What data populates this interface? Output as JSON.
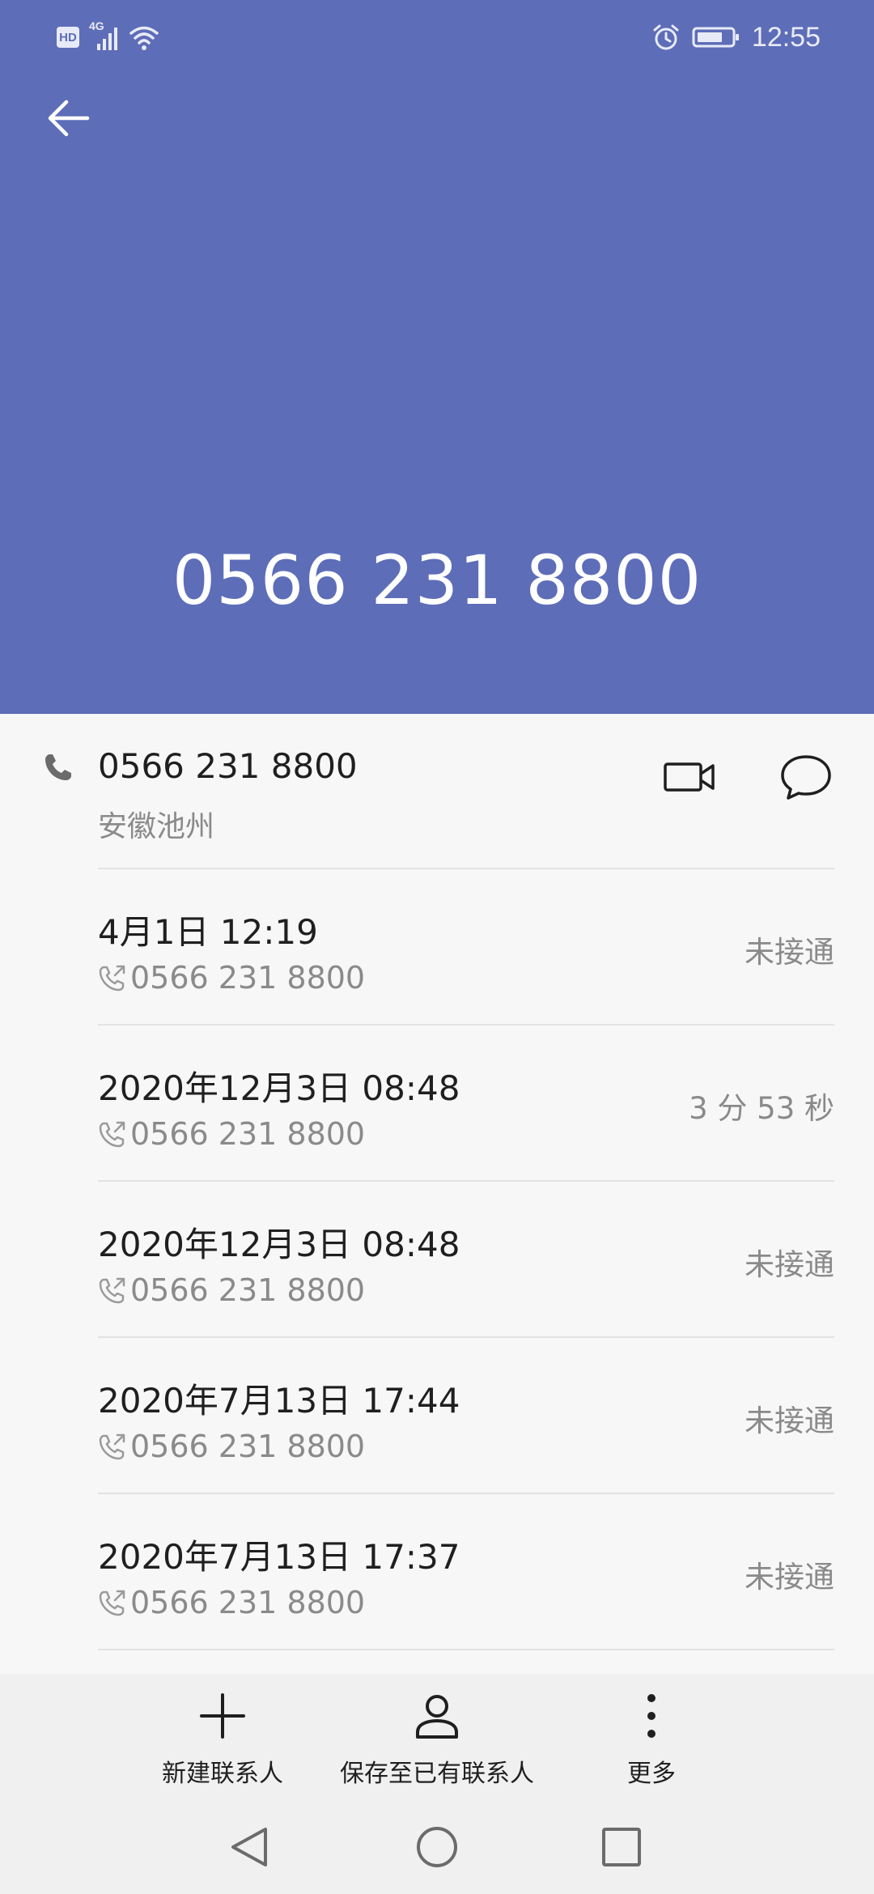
{
  "status_bar": {
    "time": "12:55",
    "hd_label": "HD",
    "network_label": "4G"
  },
  "header": {
    "phone_number": "0566 231 8800"
  },
  "contact": {
    "number": "0566 231 8800",
    "location": "安徽池州"
  },
  "call_log": [
    {
      "date": "4月1日 12:19",
      "number": "0566 231 8800",
      "status": "未接通"
    },
    {
      "date": "2020年12月3日 08:48",
      "number": "0566 231 8800",
      "status": "3 分 53 秒"
    },
    {
      "date": "2020年12月3日 08:48",
      "number": "0566 231 8800",
      "status": "未接通"
    },
    {
      "date": "2020年7月13日 17:44",
      "number": "0566 231 8800",
      "status": "未接通"
    },
    {
      "date": "2020年7月13日 17:37",
      "number": "0566 231 8800",
      "status": "未接通"
    }
  ],
  "actions": {
    "new_contact": "新建联系人",
    "save_existing": "保存至已有联系人",
    "more": "更多"
  },
  "colors": {
    "header_bg": "#5d6db8",
    "page_bg": "#f7f7f7",
    "bar_bg": "#f0f0f0"
  }
}
